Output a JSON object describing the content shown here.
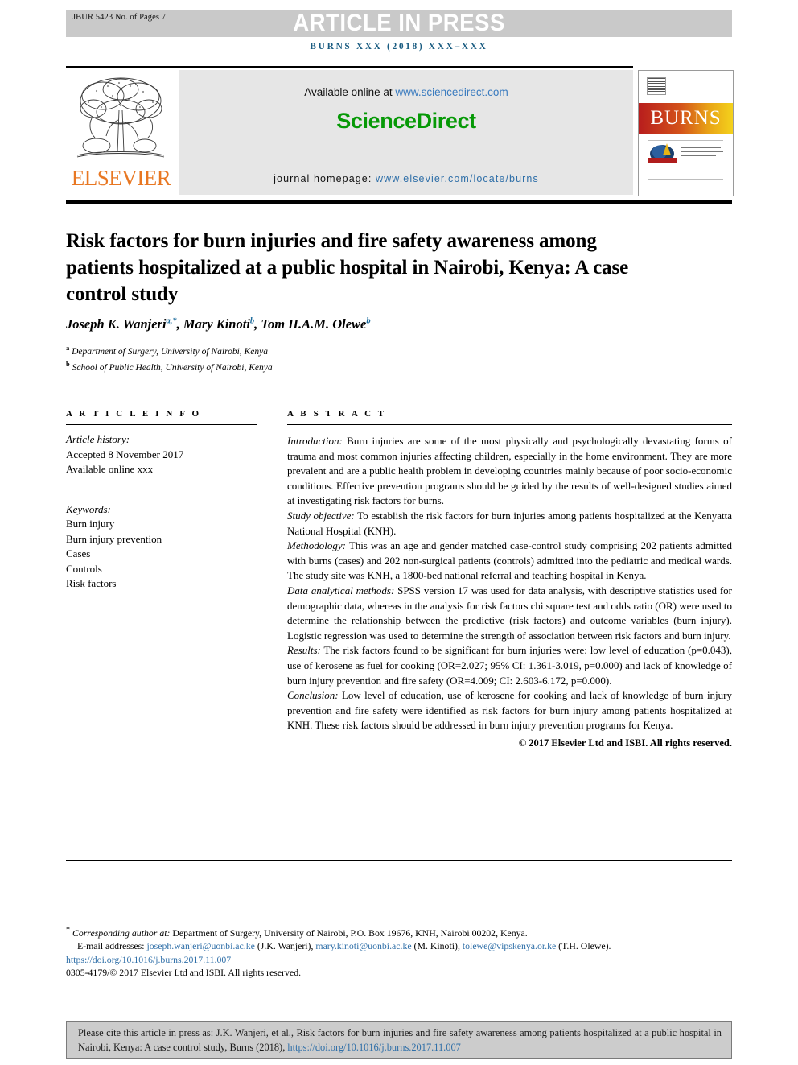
{
  "header": {
    "jbur_id": "JBUR 5423 No. of Pages 7",
    "article_in_press": "ARTICLE IN PRESS",
    "running_head": "BURNS XXX (2018) XXX–XXX"
  },
  "masthead": {
    "publisher_name": "ELSEVIER",
    "available_online_prefix": "Available online at ",
    "available_online_url": "www.sciencedirect.com",
    "sciencedirect_logo": "ScienceDirect",
    "homepage_prefix": "journal homepage: ",
    "homepage_url": "www.elsevier.com/locate/burns",
    "cover_title": "BURNS"
  },
  "article": {
    "title": "Risk factors for burn injuries and fire safety awareness among patients hospitalized at a public hospital in Nairobi, Kenya: A case control study",
    "authors_plain": "Joseph K. Wanjeri a,*, Mary Kinoti b, Tom H.A.M. Olewe b",
    "author_list": [
      {
        "name": "Joseph K. Wanjeri",
        "marks": "a,*"
      },
      {
        "name": "Mary Kinoti",
        "marks": "b"
      },
      {
        "name": "Tom H.A.M. Olewe",
        "marks": "b"
      }
    ],
    "affiliations": [
      {
        "mark": "a",
        "text": "Department of Surgery, University of Nairobi, Kenya"
      },
      {
        "mark": "b",
        "text": "School of Public Health, University of Nairobi, Kenya"
      }
    ]
  },
  "article_info": {
    "heading": "A R T I C L E   I N F O",
    "history_label": "Article history:",
    "history_lines": [
      "Accepted 8 November 2017",
      "Available online xxx"
    ],
    "keywords_label": "Keywords:",
    "keywords": [
      "Burn injury",
      "Burn injury prevention",
      "Cases",
      "Controls",
      "Risk factors"
    ]
  },
  "abstract": {
    "heading": "A B S T R A C T",
    "sections": [
      {
        "label": "Introduction:",
        "text": " Burn injuries are some of the most physically and psychologically devastating forms of trauma and most common injuries affecting children, especially in the home environment. They are more prevalent and are a public health problem in developing countries mainly because of poor socio-economic conditions. Effective prevention programs should be guided by the results of well-designed studies aimed at investigating risk factors for burns."
      },
      {
        "label": "Study objective:",
        "text": " To establish the risk factors for burn injuries among patients hospitalized at the Kenyatta National Hospital (KNH)."
      },
      {
        "label": "Methodology:",
        "text": " This was an age and gender matched case-control study comprising 202 patients admitted with burns (cases) and 202 non-surgical patients (controls) admitted into the pediatric and medical wards. The study site was KNH, a 1800-bed national referral and teaching hospital in Kenya."
      },
      {
        "label": "Data analytical methods:",
        "text": " SPSS version 17 was used for data analysis, with descriptive statistics used for demographic data, whereas in the analysis for risk factors chi square test and odds ratio (OR) were used to determine the relationship between the predictive (risk factors) and outcome variables (burn injury). Logistic regression was used to determine the strength of association between risk factors and burn injury."
      },
      {
        "label": "Results:",
        "text": " The risk factors found to be significant for burn injuries were: low level of education (p=0.043), use of kerosene as fuel for cooking (OR=2.027; 95% CI: 1.361-3.019, p=0.000) and lack of knowledge of burn injury prevention and fire safety (OR=4.009; CI: 2.603-6.172, p=0.000)."
      },
      {
        "label": "Conclusion:",
        "text": " Low level of education, use of kerosene for cooking and lack of knowledge of burn injury prevention and fire safety were identified as risk factors for burn injury among patients hospitalized at KNH. These risk factors should be addressed in burn injury prevention programs for Kenya."
      }
    ],
    "copyright": "© 2017 Elsevier Ltd and ISBI. All rights reserved."
  },
  "footnotes": {
    "corresponding_label": "Corresponding author at:",
    "corresponding_text": " Department of Surgery, University of Nairobi, P.O. Box 19676, KNH, Nairobi 00202, Kenya.",
    "email_label": "E-mail addresses:",
    "emails": [
      {
        "address": "joseph.wanjeri@uonbi.ac.ke",
        "owner": "(J.K. Wanjeri)"
      },
      {
        "address": "mary.kinoti@uonbi.ac.ke",
        "owner": "(M. Kinoti)"
      },
      {
        "address": "tolewe@vipskenya.or.ke",
        "owner": "(T.H. Olewe)."
      }
    ],
    "doi": "https://doi.org/10.1016/j.burns.2017.11.007",
    "issn_line": "0305-4179/© 2017 Elsevier Ltd and ISBI. All rights reserved."
  },
  "citation_box": {
    "text_before_link": "Please cite this article in press as: J.K. Wanjeri, et al., Risk factors for burn injuries and fire safety awareness among patients hospitalized at a public hospital in Nairobi, Kenya: A case control study, Burns (2018), ",
    "link": "https://doi.org/10.1016/j.burns.2017.11.007"
  },
  "colors": {
    "banner_gray": "#c9c9c9",
    "running_head_blue": "#1b5d82",
    "sciencedirect_green": "#069906",
    "elsevier_orange": "#e87722",
    "link_blue": "#2f6fa8",
    "cite_box_gray": "#cccccc"
  }
}
